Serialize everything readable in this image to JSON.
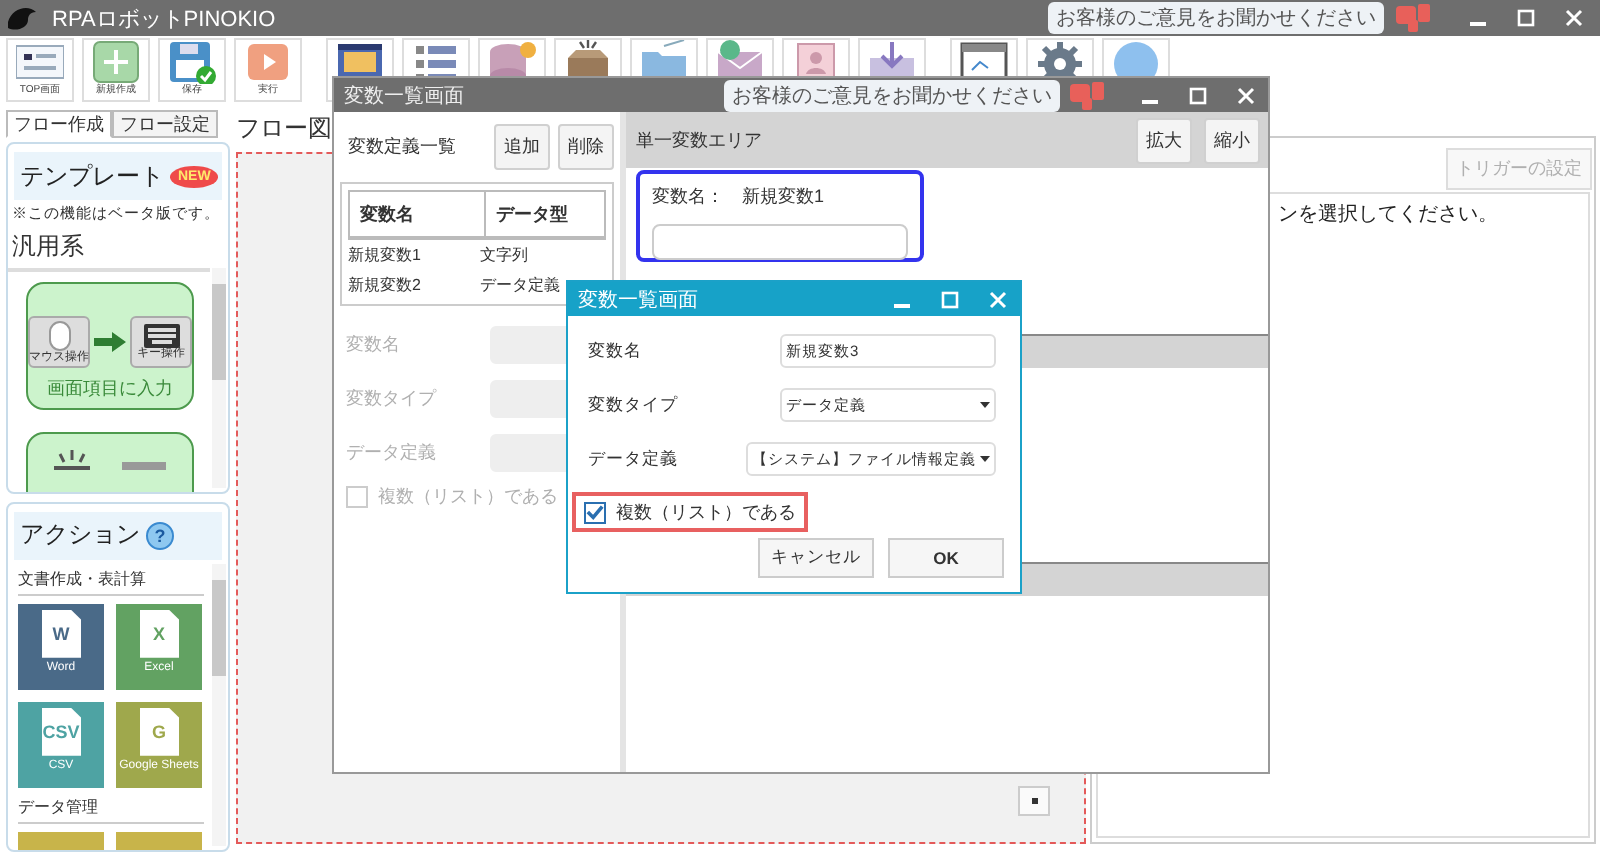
{
  "app": {
    "title": "RPAロボットPINOKIO",
    "feedback": "お客様のご意見をお聞かせください"
  },
  "toolbar": [
    [
      {
        "kind": "top",
        "label": "TOP画面"
      },
      {
        "kind": "new",
        "label": "新規作成"
      },
      {
        "kind": "save",
        "label": "保存"
      },
      {
        "kind": "run",
        "label": "実行"
      }
    ],
    [
      {
        "kind": "video"
      },
      {
        "kind": "list"
      },
      {
        "kind": "database"
      },
      {
        "kind": "box"
      },
      {
        "kind": "folder"
      },
      {
        "kind": "mail"
      },
      {
        "kind": "contact"
      },
      {
        "kind": "download"
      }
    ],
    [
      {
        "kind": "window"
      },
      {
        "kind": "gear"
      },
      {
        "kind": "help"
      }
    ]
  ],
  "tabs": [
    {
      "label": "フロー作成",
      "selected": true
    },
    {
      "label": "フロー設定",
      "selected": false
    }
  ],
  "template_panel": {
    "title": "テンプレート",
    "badge": "NEW",
    "note": "※この機能はベータ版です。",
    "category": "汎用系",
    "cards": [
      {
        "kind": "input",
        "label": "画面項目に入力",
        "from_label": "マウス操作",
        "to_label": "キー操作"
      },
      {
        "kind": "partial"
      }
    ]
  },
  "action_panel": {
    "title": "アクション",
    "help": "?",
    "sections": [
      {
        "title": "文書作成・表計算",
        "tiles": [
          {
            "label": "Word",
            "mark": "W",
            "color": "#4a6a88"
          },
          {
            "label": "Excel",
            "mark": "X",
            "color": "#62a262"
          },
          {
            "label": "CSV",
            "mark": "CSV",
            "color": "#4ea3a3"
          },
          {
            "label": "Google Sheets",
            "mark": "G",
            "color": "#9fa84c"
          }
        ]
      },
      {
        "title": "データ管理",
        "tiles": [
          {
            "color": "#c8b44a"
          },
          {
            "color": "#c8b44a"
          }
        ]
      }
    ]
  },
  "flow_area": {
    "title": "フロー図"
  },
  "settings_panel": {
    "trigger_button": {
      "label": "トリガーの設定",
      "disabled": true
    },
    "message": "ンを選択してください。"
  },
  "variable_window": {
    "title": "変数一覧画面",
    "feedback": "お客様のご意見をお聞かせください",
    "list_title": "変数定義一覧",
    "buttons": [
      "追加",
      "削除"
    ],
    "columns": [
      "変数名",
      "データ型"
    ],
    "rows": [
      [
        "新規変数1",
        "文字列"
      ],
      [
        "新規変数2",
        "データ定義"
      ]
    ],
    "form": {
      "disabled": true,
      "fields": [
        "変数名",
        "変数タイプ",
        "データ定義"
      ],
      "checkbox": {
        "label": "複数（リスト）である",
        "checked": false
      }
    },
    "single_area": {
      "title": "単一変数エリア",
      "buttons": [
        "拡大",
        "縮小"
      ],
      "name_label": "変数名：",
      "name_value": "新規変数1"
    }
  },
  "dialog": {
    "title": "変数一覧画面",
    "fields": [
      {
        "label": "変数名",
        "kind": "text",
        "value": "新規変数3"
      },
      {
        "label": "変数タイプ",
        "kind": "select",
        "value": "データ定義"
      },
      {
        "label": "データ定義",
        "kind": "select",
        "value": "【システム】ファイル情報定義"
      }
    ],
    "checkbox": {
      "label": "複数（リスト）である",
      "checked": true,
      "highlighted": true
    },
    "buttons": [
      "キャンセル",
      "OK"
    ]
  }
}
